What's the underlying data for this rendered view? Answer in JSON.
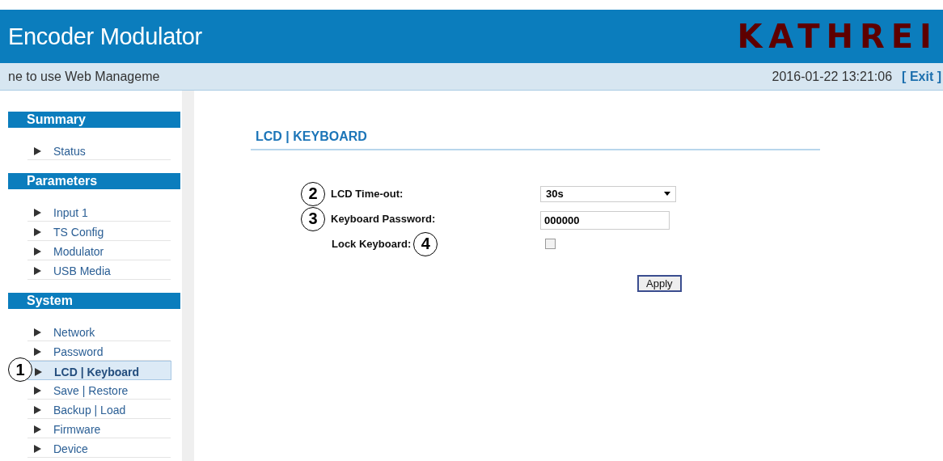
{
  "header": {
    "title": "Encoder Modulator",
    "logo": "KATHREI"
  },
  "info_bar": {
    "message": "ne to use Web Manageme",
    "datetime": "2016-01-22 13:21:06",
    "exit": "[ Exit ]"
  },
  "sidebar": {
    "sections": [
      {
        "title": "Summary",
        "items": [
          {
            "label": "Status",
            "selected": false
          }
        ]
      },
      {
        "title": "Parameters",
        "items": [
          {
            "label": "Input 1",
            "selected": false
          },
          {
            "label": "TS Config",
            "selected": false
          },
          {
            "label": "Modulator",
            "selected": false
          },
          {
            "label": "USB Media",
            "selected": false
          }
        ]
      },
      {
        "title": "System",
        "items": [
          {
            "label": "Network",
            "selected": false
          },
          {
            "label": "Password",
            "selected": false
          },
          {
            "label": "LCD | Keyboard",
            "selected": true,
            "callout": "1"
          },
          {
            "label": "Save | Restore",
            "selected": false
          },
          {
            "label": "Backup | Load",
            "selected": false
          },
          {
            "label": "Firmware",
            "selected": false
          },
          {
            "label": "Device",
            "selected": false
          }
        ]
      }
    ]
  },
  "content": {
    "title": "LCD | KEYBOARD",
    "fields": [
      {
        "kind": "select",
        "label": "LCD Time-out:",
        "value": "30s",
        "callout": "2"
      },
      {
        "kind": "text",
        "label": "Keyboard Password:",
        "value": "000000",
        "callout": "3"
      },
      {
        "kind": "checkbox",
        "label": "Lock Keyboard:",
        "checked": false,
        "callout_after": "4"
      }
    ],
    "apply": "Apply"
  }
}
